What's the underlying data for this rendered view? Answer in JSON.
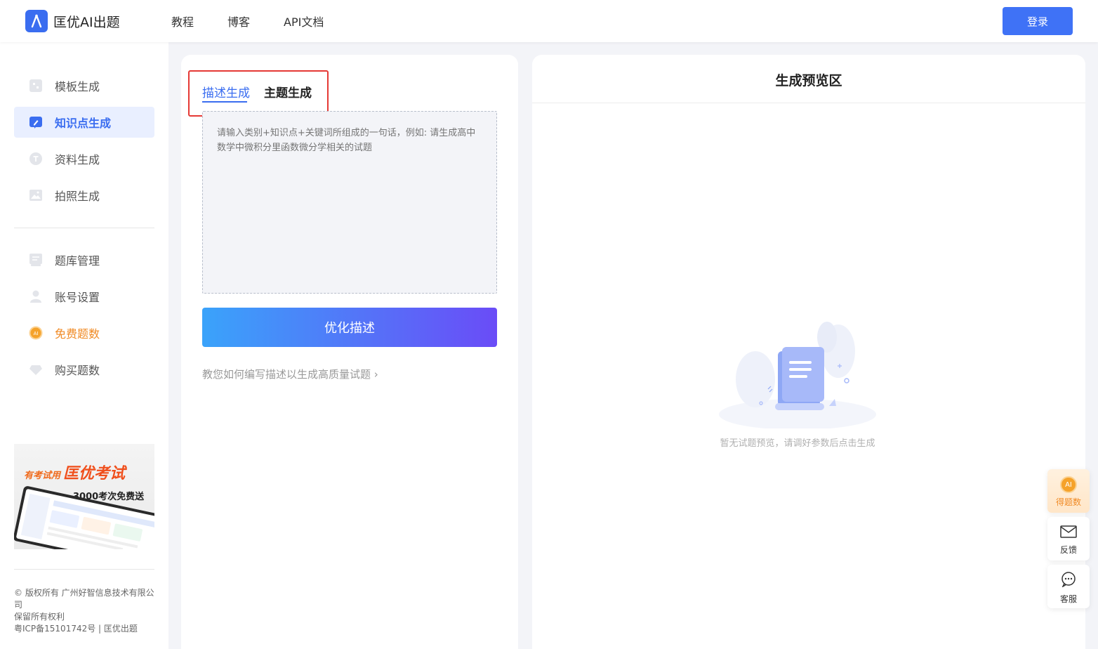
{
  "header": {
    "app_name": "匡优AI出题",
    "nav": [
      "教程",
      "博客",
      "API文档"
    ],
    "login_label": "登录"
  },
  "sidebar": {
    "items": [
      {
        "label": "模板生成",
        "icon": "template-icon"
      },
      {
        "label": "知识点生成",
        "icon": "knowledge-edit-icon",
        "active": true
      },
      {
        "label": "资料生成",
        "icon": "text-doc-icon"
      },
      {
        "label": "拍照生成",
        "icon": "photo-icon"
      }
    ],
    "items2": [
      {
        "label": "题库管理",
        "icon": "question-bank-icon"
      },
      {
        "label": "账号设置",
        "icon": "user-icon"
      },
      {
        "label": "免费题数",
        "icon": "ai-coin-icon"
      },
      {
        "label": "购买题数",
        "icon": "diamond-icon"
      }
    ],
    "promo": {
      "small": "有考试用",
      "big": "匡优考试",
      "sub": "3000考次免费送"
    },
    "footer": {
      "line1": "© 版权所有 广州好智信息技术有限公司",
      "line2": "保留所有权利",
      "line3": "粤ICP备15101742号 | 匡优出题"
    }
  },
  "editor": {
    "tabs": [
      "描述生成",
      "主题生成"
    ],
    "active_tab": "描述生成",
    "placeholder": "请输入类别+知识点+关键词所组成的一句话，例如: 请生成高中数学中微积分里函数微分学相关的试题",
    "value": "",
    "optimize_label": "优化描述",
    "howto_label": "教您如何编写描述以生成高质量试题 ›"
  },
  "preview": {
    "title": "生成预览区",
    "empty_text": "暂无试题预览，请调好参数后点击生成"
  },
  "floating": {
    "points_label": "得题数",
    "feedback_label": "反馈",
    "service_label": "客服"
  },
  "colors": {
    "primary": "#3a6df0",
    "accent_orange": "#f08a24",
    "highlight_red": "#e53935"
  }
}
